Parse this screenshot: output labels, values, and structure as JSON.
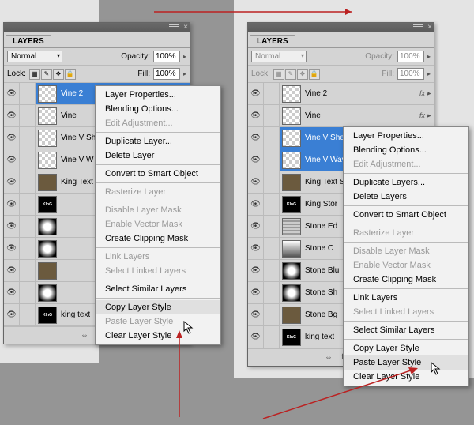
{
  "panel_left": {
    "title": "LAYERS",
    "blend_mode": "Normal",
    "opacity_label": "Opacity:",
    "opacity": "100%",
    "lock_label": "Lock:",
    "fill_label": "Fill:",
    "fill": "100%",
    "layers": [
      {
        "name": "Vine 2",
        "selected": true,
        "thumb": "checker"
      },
      {
        "name": "Vine",
        "thumb": "checker"
      },
      {
        "name": "Vine V Sh",
        "thumb": "checker"
      },
      {
        "name": "Vine V W",
        "thumb": "checker"
      },
      {
        "name": "King Text",
        "thumb": "texture"
      },
      {
        "name": "",
        "thumb": "blackbox",
        "text": "KInG"
      },
      {
        "name": "",
        "thumb": "radial"
      },
      {
        "name": "",
        "thumb": "radial"
      },
      {
        "name": "",
        "thumb": "texture"
      },
      {
        "name": "",
        "thumb": "radial"
      },
      {
        "name": "king text",
        "thumb": "blackbox",
        "text": "KInG"
      }
    ]
  },
  "panel_right": {
    "title": "LAYERS",
    "blend_mode": "Normal",
    "opacity_label": "Opacity:",
    "opacity": "100%",
    "lock_label": "Lock:",
    "fill_label": "Fill:",
    "fill": "100%",
    "layers": [
      {
        "name": "Vine 2",
        "thumb": "checker",
        "fx": true
      },
      {
        "name": "Vine",
        "thumb": "checker",
        "fx": true
      },
      {
        "name": "Vine V Shear",
        "thumb": "checker",
        "selected": true
      },
      {
        "name": "Vine V Wave",
        "thumb": "checker",
        "selected": true
      },
      {
        "name": "King Text Sharp",
        "thumb": "texture"
      },
      {
        "name": "King Stor",
        "thumb": "blackbox",
        "text": "KInG"
      },
      {
        "name": "Stone Ed",
        "thumb": "stripes"
      },
      {
        "name": "Stone C",
        "thumb": "linear-v"
      },
      {
        "name": "Stone Blu",
        "thumb": "radial"
      },
      {
        "name": "Stone Sh",
        "thumb": "radial"
      },
      {
        "name": "Stone Bg",
        "thumb": "texture"
      },
      {
        "name": "king text",
        "thumb": "blackbox",
        "text": "KInG"
      }
    ]
  },
  "ctx_left": [
    {
      "label": "Layer Properties..."
    },
    {
      "label": "Blending Options..."
    },
    {
      "label": "Edit Adjustment...",
      "disabled": true
    },
    {
      "sep": true
    },
    {
      "label": "Duplicate Layer..."
    },
    {
      "label": "Delete Layer"
    },
    {
      "sep": true
    },
    {
      "label": "Convert to Smart Object"
    },
    {
      "sep": true
    },
    {
      "label": "Rasterize Layer",
      "disabled": true
    },
    {
      "sep": true
    },
    {
      "label": "Disable Layer Mask",
      "disabled": true
    },
    {
      "label": "Enable Vector Mask",
      "disabled": true
    },
    {
      "label": "Create Clipping Mask"
    },
    {
      "sep": true
    },
    {
      "label": "Link Layers",
      "disabled": true
    },
    {
      "label": "Select Linked Layers",
      "disabled": true
    },
    {
      "sep": true
    },
    {
      "label": "Select Similar Layers"
    },
    {
      "sep": true
    },
    {
      "label": "Copy Layer Style",
      "hover": true
    },
    {
      "label": "Paste Layer Style",
      "disabled": true
    },
    {
      "label": "Clear Layer Style"
    }
  ],
  "ctx_right": [
    {
      "label": "Layer Properties..."
    },
    {
      "label": "Blending Options..."
    },
    {
      "label": "Edit Adjustment...",
      "disabled": true
    },
    {
      "sep": true
    },
    {
      "label": "Duplicate Layers..."
    },
    {
      "label": "Delete Layers"
    },
    {
      "sep": true
    },
    {
      "label": "Convert to Smart Object"
    },
    {
      "sep": true
    },
    {
      "label": "Rasterize Layer",
      "disabled": true
    },
    {
      "sep": true
    },
    {
      "label": "Disable Layer Mask",
      "disabled": true
    },
    {
      "label": "Enable Vector Mask",
      "disabled": true
    },
    {
      "label": "Create Clipping Mask"
    },
    {
      "sep": true
    },
    {
      "label": "Link Layers"
    },
    {
      "label": "Select Linked Layers",
      "disabled": true
    },
    {
      "sep": true
    },
    {
      "label": "Select Similar Layers"
    },
    {
      "sep": true
    },
    {
      "label": "Copy Layer Style"
    },
    {
      "label": "Paste Layer Style",
      "hover": true
    },
    {
      "label": "Clear Layer Style"
    }
  ]
}
